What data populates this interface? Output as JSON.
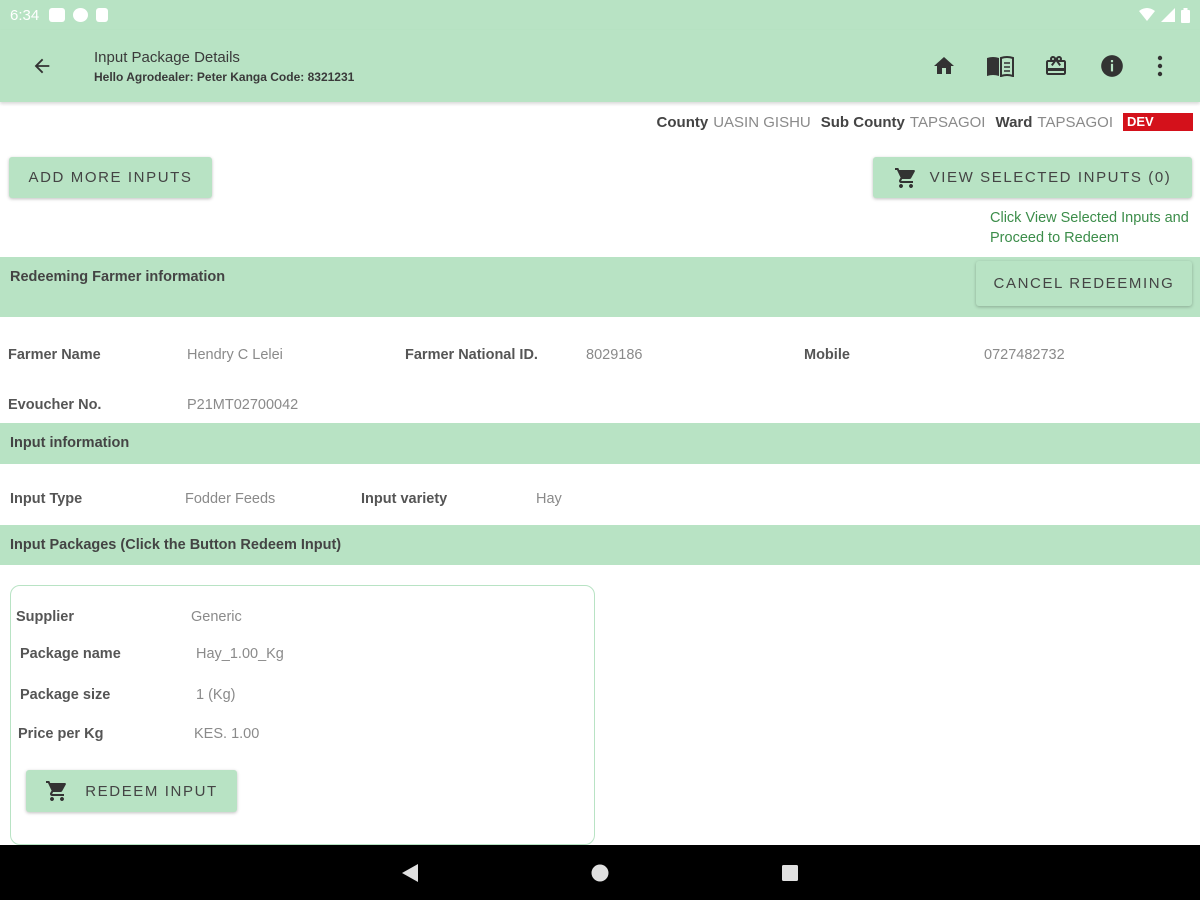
{
  "status": {
    "time": "6:34"
  },
  "appbar": {
    "title": "Input Package Details",
    "subtitle": "Hello Agrodealer: Peter Kanga Code: 8321231"
  },
  "location": {
    "county_label": "County",
    "county": "UASIN GISHU",
    "subcounty_label": "Sub County",
    "subcounty": "TAPSAGOI",
    "ward_label": "Ward",
    "ward": "TAPSAGOI",
    "env": "DEV"
  },
  "buttons": {
    "add_more": "ADD MORE INPUTS",
    "view_selected": "VIEW SELECTED INPUTS (0)",
    "cancel_redeeming": "CANCEL REDEEMING",
    "redeem_input": "REDEEM INPUT"
  },
  "hint": "Click View Selected Inputs and Proceed to Redeem",
  "farmer": {
    "section_title": "Redeeming Farmer information",
    "name_label": "Farmer Name",
    "name": "Hendry C Lelei",
    "id_label": "Farmer National ID.",
    "id": "8029186",
    "mobile_label": "Mobile",
    "mobile": "0727482732",
    "evoucher_label": "Evoucher No.",
    "evoucher": "P21MT02700042"
  },
  "input_info": {
    "section_title": "Input information",
    "type_label": "Input Type",
    "type": "Fodder Feeds",
    "variety_label": "Input variety",
    "variety": "Hay"
  },
  "packages": {
    "section_title": "Input Packages (Click the Button Redeem Input)",
    "supplier_label": "Supplier",
    "supplier": "Generic",
    "package_name_label": "Package name",
    "package_name": "Hay_1.00_Kg",
    "package_size_label": "Package size",
    "package_size": "1 (Kg)",
    "price_label": "Price per Kg",
    "price": "KES. 1.00"
  },
  "icons": {
    "back": "arrow-left-icon",
    "home": "home-icon",
    "book": "book-icon",
    "gift": "gift-icon",
    "info": "info-icon",
    "more": "more-vert-icon",
    "cart": "cart-icon"
  },
  "colors": {
    "accent": "#b8e3c4",
    "hint": "#3c8d4a",
    "dev": "#d4111b"
  }
}
